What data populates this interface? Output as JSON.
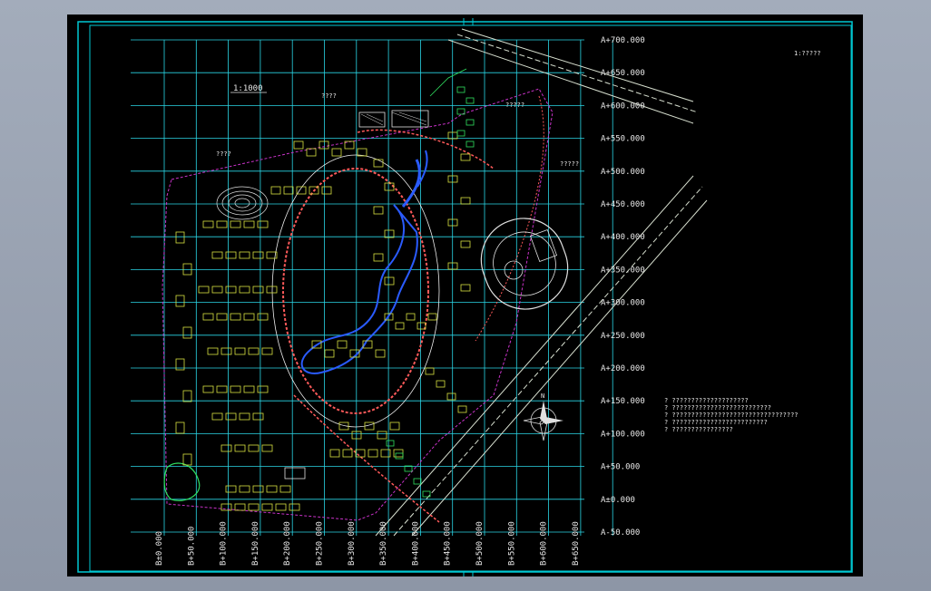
{
  "drawing": {
    "scale_label": "1:1000",
    "corner_note": "1:?????",
    "area_notes": [
      "????",
      "????",
      "?????",
      "?????"
    ],
    "north_label": "N",
    "y_grid_labels": [
      "A+700.000",
      "A+650.000",
      "A+600.000",
      "A+550.000",
      "A+500.000",
      "A+450.000",
      "A+400.000",
      "A+350.000",
      "A+300.000",
      "A+250.000",
      "A+200.000",
      "A+150.000",
      "A+100.000",
      "A+50.000",
      "A±0.000",
      "A-50.000"
    ],
    "x_grid_labels": [
      "B±0.000",
      "B+50.000",
      "B+100.000",
      "B+150.000",
      "B+200.000",
      "B+250.000",
      "B+300.000",
      "B+350.000",
      "B+400.000",
      "B+450.000",
      "B+500.000",
      "B+550.000",
      "B+600.000",
      "B+650.000"
    ],
    "legend_lines": [
      "? ????????????????????",
      "? ??????????????????????????",
      "? ?????????????????????????????????",
      "? ?????????????????????????",
      "? ????????????????"
    ],
    "colors": {
      "frame": "#00c8d2",
      "grid": "#2ad6e6",
      "buildings": "#d8e040",
      "roads": "#ff5a5a",
      "water": "#2a5bff",
      "boundary": "#c832c8",
      "green": "#30e060"
    }
  }
}
